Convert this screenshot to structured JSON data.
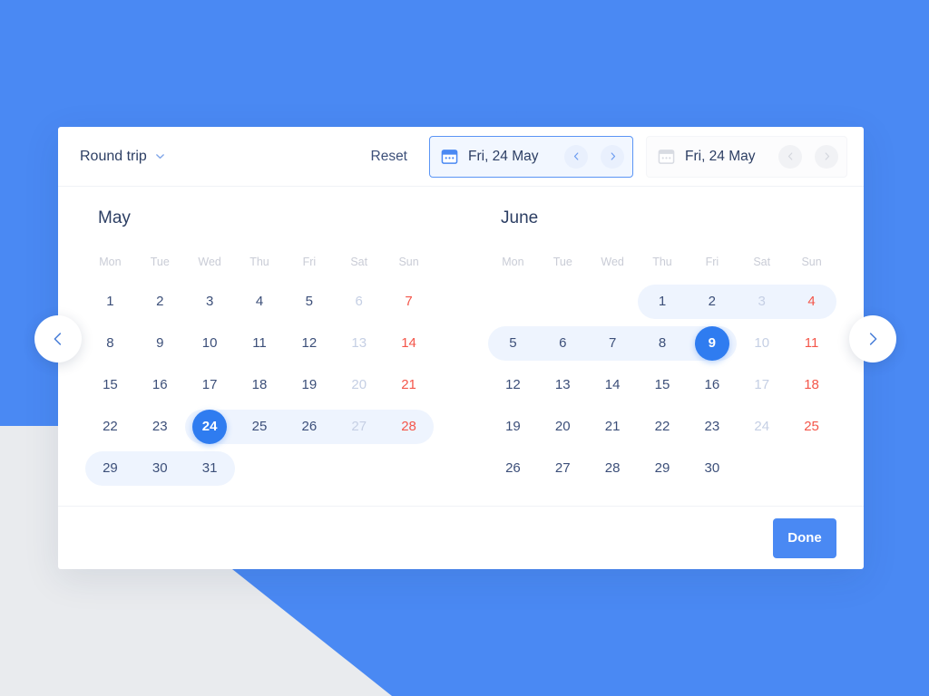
{
  "theme": {
    "accent": "#4a89f3",
    "accent_dark": "#2f7cf0",
    "background": "#e9ebee",
    "card": "#ffffff",
    "range_highlight": "#eef4fe",
    "text": "#2c3e63",
    "muted": "#c9ccd6",
    "saturday": "#c5cfe4",
    "sunday": "#f4564a"
  },
  "header": {
    "trip_type_label": "Round trip",
    "chevron_icon": "chevron-down-icon",
    "reset_label": "Reset",
    "departure_field": {
      "icon": "calendar-icon",
      "value": "Fri, 24 May",
      "prev_icon": "chevron-left-icon",
      "next_icon": "chevron-right-icon",
      "state": "active"
    },
    "return_field": {
      "icon": "calendar-icon",
      "value": "Fri, 24 May",
      "prev_icon": "chevron-left-icon",
      "next_icon": "chevron-right-icon",
      "state": "disabled"
    }
  },
  "nav": {
    "prev_icon": "chevron-left-icon",
    "next_icon": "chevron-right-icon"
  },
  "weekdays": [
    "Mon",
    "Tue",
    "Wed",
    "Thu",
    "Fri",
    "Sat",
    "Sun"
  ],
  "months": [
    {
      "title": "May",
      "weeks": [
        [
          {
            "d": "1"
          },
          {
            "d": "2"
          },
          {
            "d": "3"
          },
          {
            "d": "4"
          },
          {
            "d": "5"
          },
          {
            "d": "6",
            "sat": true
          },
          {
            "d": "7",
            "sun": true
          }
        ],
        [
          {
            "d": "8"
          },
          {
            "d": "9"
          },
          {
            "d": "10"
          },
          {
            "d": "11"
          },
          {
            "d": "12"
          },
          {
            "d": "13",
            "sat": true
          },
          {
            "d": "14",
            "sun": true
          }
        ],
        [
          {
            "d": "15"
          },
          {
            "d": "16"
          },
          {
            "d": "17"
          },
          {
            "d": "18"
          },
          {
            "d": "19"
          },
          {
            "d": "20",
            "sat": true
          },
          {
            "d": "21",
            "sun": true
          }
        ],
        [
          {
            "d": "22"
          },
          {
            "d": "23"
          },
          {
            "d": "24",
            "selected": true,
            "range": "start"
          },
          {
            "d": "25",
            "range": "mid"
          },
          {
            "d": "26",
            "range": "mid"
          },
          {
            "d": "27",
            "sat": true,
            "range": "mid"
          },
          {
            "d": "28",
            "sun": true,
            "range": "end"
          }
        ],
        [
          {
            "d": "29",
            "range": "start"
          },
          {
            "d": "30",
            "range": "mid"
          },
          {
            "d": "31",
            "range": "end"
          },
          {
            "d": ""
          },
          {
            "d": ""
          },
          {
            "d": ""
          },
          {
            "d": ""
          }
        ]
      ]
    },
    {
      "title": "June",
      "weeks": [
        [
          {
            "d": ""
          },
          {
            "d": ""
          },
          {
            "d": ""
          },
          {
            "d": "1",
            "range": "start"
          },
          {
            "d": "2",
            "range": "mid"
          },
          {
            "d": "3",
            "sat": true,
            "range": "mid"
          },
          {
            "d": "4",
            "sun": true,
            "range": "end"
          }
        ],
        [
          {
            "d": "5",
            "range": "start"
          },
          {
            "d": "6",
            "range": "mid"
          },
          {
            "d": "7",
            "range": "mid"
          },
          {
            "d": "8",
            "range": "mid"
          },
          {
            "d": "9",
            "selected": true,
            "range": "end"
          },
          {
            "d": "10",
            "sat": true
          },
          {
            "d": "11",
            "sun": true
          }
        ],
        [
          {
            "d": "12"
          },
          {
            "d": "13"
          },
          {
            "d": "14"
          },
          {
            "d": "15"
          },
          {
            "d": "16"
          },
          {
            "d": "17",
            "sat": true
          },
          {
            "d": "18",
            "sun": true
          }
        ],
        [
          {
            "d": "19"
          },
          {
            "d": "20"
          },
          {
            "d": "21"
          },
          {
            "d": "22"
          },
          {
            "d": "23"
          },
          {
            "d": "24",
            "sat": true
          },
          {
            "d": "25",
            "sun": true
          }
        ],
        [
          {
            "d": "26"
          },
          {
            "d": "27"
          },
          {
            "d": "28"
          },
          {
            "d": "29"
          },
          {
            "d": "30"
          },
          {
            "d": ""
          },
          {
            "d": ""
          }
        ]
      ]
    }
  ],
  "footer": {
    "done_label": "Done"
  }
}
